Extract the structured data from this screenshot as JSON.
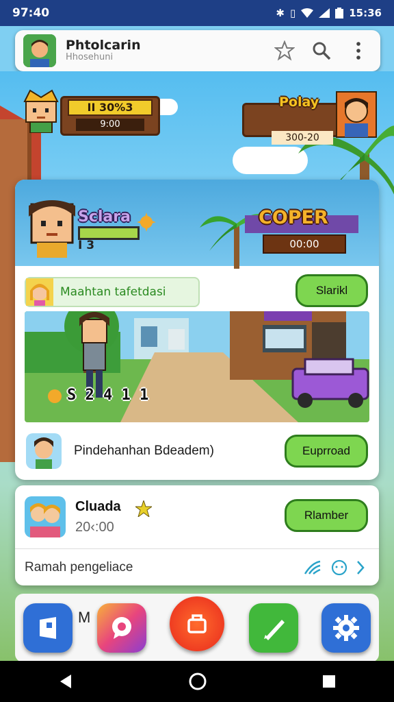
{
  "status": {
    "time": "97:40",
    "clock": "15:36"
  },
  "appbar": {
    "title": "Phtolcarin",
    "subtitle": "Hhosehuni"
  },
  "hud": {
    "left_title": "II 30%3",
    "left_value": "9:00",
    "right_name": "Polay",
    "right_value": "300-20"
  },
  "versus": {
    "left_name": "Sclara",
    "left_score": "I 3",
    "right_name": "COPER",
    "right_timer": "00:00"
  },
  "mission": {
    "label": "Maahtan tafetdasi",
    "button": "Slarikl"
  },
  "street": {
    "score": "S 2 4 1 1"
  },
  "info": {
    "text": "Pindehanhan Bdeadem)",
    "button": "Euprroad"
  },
  "friend": {
    "title": "Cluada",
    "time": "20‹:00",
    "button": "Rlamber",
    "footer": "Ramah pengeliace"
  },
  "third": {
    "title": "M"
  },
  "colors": {
    "accent_green": "#7ed650",
    "status_bar": "#1e3f86"
  }
}
